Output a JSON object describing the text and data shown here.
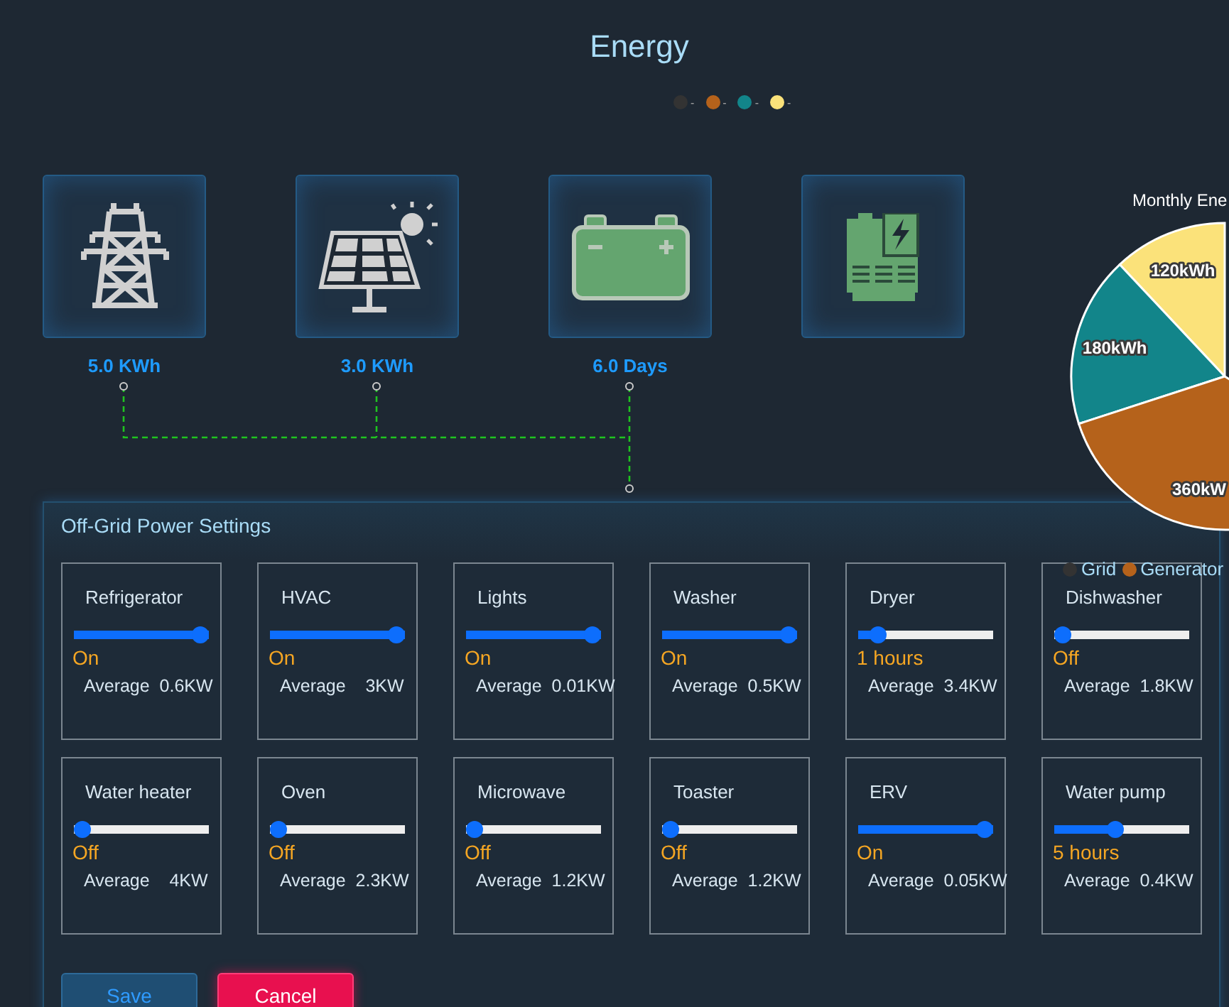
{
  "title": "Energy",
  "legend_dots": [
    {
      "color": "#333333",
      "label": "-"
    },
    {
      "color": "#b5621b",
      "label": "-"
    },
    {
      "color": "#12858a",
      "label": "-"
    },
    {
      "color": "#fbe27a",
      "label": "-"
    }
  ],
  "sources": [
    {
      "kind": "tower",
      "reading": "5.0 KWh"
    },
    {
      "kind": "solar",
      "reading": "3.0 KWh"
    },
    {
      "kind": "battery",
      "reading": "6.0 Days"
    },
    {
      "kind": "generator"
    }
  ],
  "chart": {
    "chart_data": {
      "type": "pie",
      "title": "Monthly Ene",
      "values": [
        120,
        180,
        360
      ],
      "colors": [
        "#fbe27a",
        "#12858a",
        "#b5621b"
      ],
      "value_labels": [
        "120kWh",
        "180kWh",
        "360kW"
      ]
    },
    "legend": [
      {
        "label": "Grid",
        "color": "#333333"
      },
      {
        "label": "Generator",
        "color": "#b5621b"
      }
    ]
  },
  "panel": {
    "title": "Off-Grid Power Settings",
    "devices": [
      {
        "name": "Refrigerator",
        "level": 1,
        "status": "On",
        "average": "Average  0.6KW"
      },
      {
        "name": "HVAC",
        "level": 1,
        "status": "On",
        "average": "Average    3KW"
      },
      {
        "name": "Lights",
        "level": 1,
        "status": "On",
        "average": "Average  0.01KW"
      },
      {
        "name": "Washer",
        "level": 1,
        "status": "On",
        "average": "Average  0.5KW"
      },
      {
        "name": "Dryer",
        "level": 0.1,
        "status": "1 hours",
        "average": "Average  3.4KW"
      },
      {
        "name": "Dishwasher",
        "level": 0,
        "status": "Off",
        "average": "Average  1.8KW"
      },
      {
        "name": "Water heater",
        "level": 0,
        "status": "Off",
        "average": "Average    4KW"
      },
      {
        "name": "Oven",
        "level": 0,
        "status": "Off",
        "average": "Average  2.3KW"
      },
      {
        "name": "Microwave",
        "level": 0,
        "status": "Off",
        "average": "Average  1.2KW"
      },
      {
        "name": "Toaster",
        "level": 0,
        "status": "Off",
        "average": "Average  1.2KW"
      },
      {
        "name": "ERV",
        "level": 1,
        "status": "On",
        "average": "Average  0.05KW"
      },
      {
        "name": "Water pump",
        "level": 0.45,
        "status": "5 hours",
        "average": "Average  0.4KW"
      }
    ],
    "buttons": [
      {
        "kind": "save",
        "label": "Save"
      },
      {
        "kind": "cancel",
        "label": "Cancel"
      }
    ]
  }
}
